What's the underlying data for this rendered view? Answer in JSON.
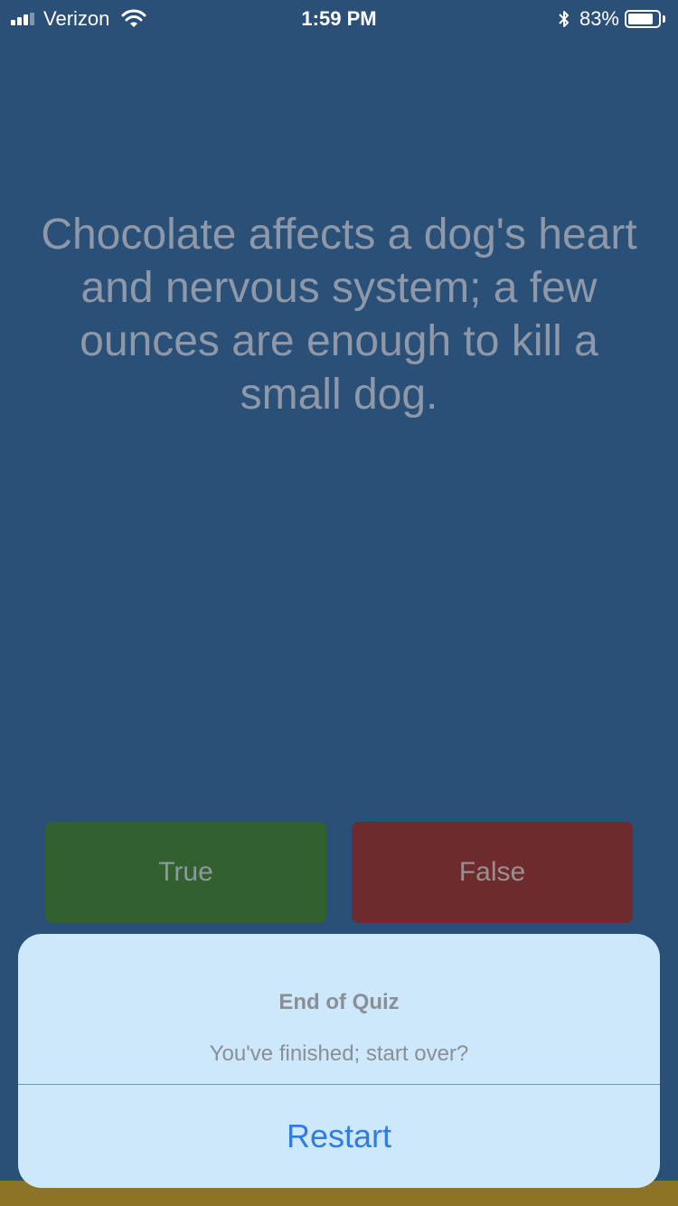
{
  "status_bar": {
    "carrier": "Verizon",
    "time": "1:59 PM",
    "battery_percent": "83%",
    "battery_level": 0.83,
    "signal_bars": 3,
    "icons": [
      "signal-icon",
      "wifi-icon",
      "bluetooth-icon",
      "battery-icon"
    ]
  },
  "question": {
    "text": "Chocolate affects a dog's heart and nervous system; a few ounces are enough to kill a small dog."
  },
  "answers": {
    "true_label": "True",
    "false_label": "False"
  },
  "alert": {
    "title": "End of Quiz",
    "message": "You've finished; start over?",
    "action_label": "Restart"
  },
  "colors": {
    "background": "#2a5078",
    "true_button": "#32602f",
    "false_button": "#6e2b2d",
    "alert_background": "#cde7fb",
    "alert_action": "#2f7de1"
  }
}
